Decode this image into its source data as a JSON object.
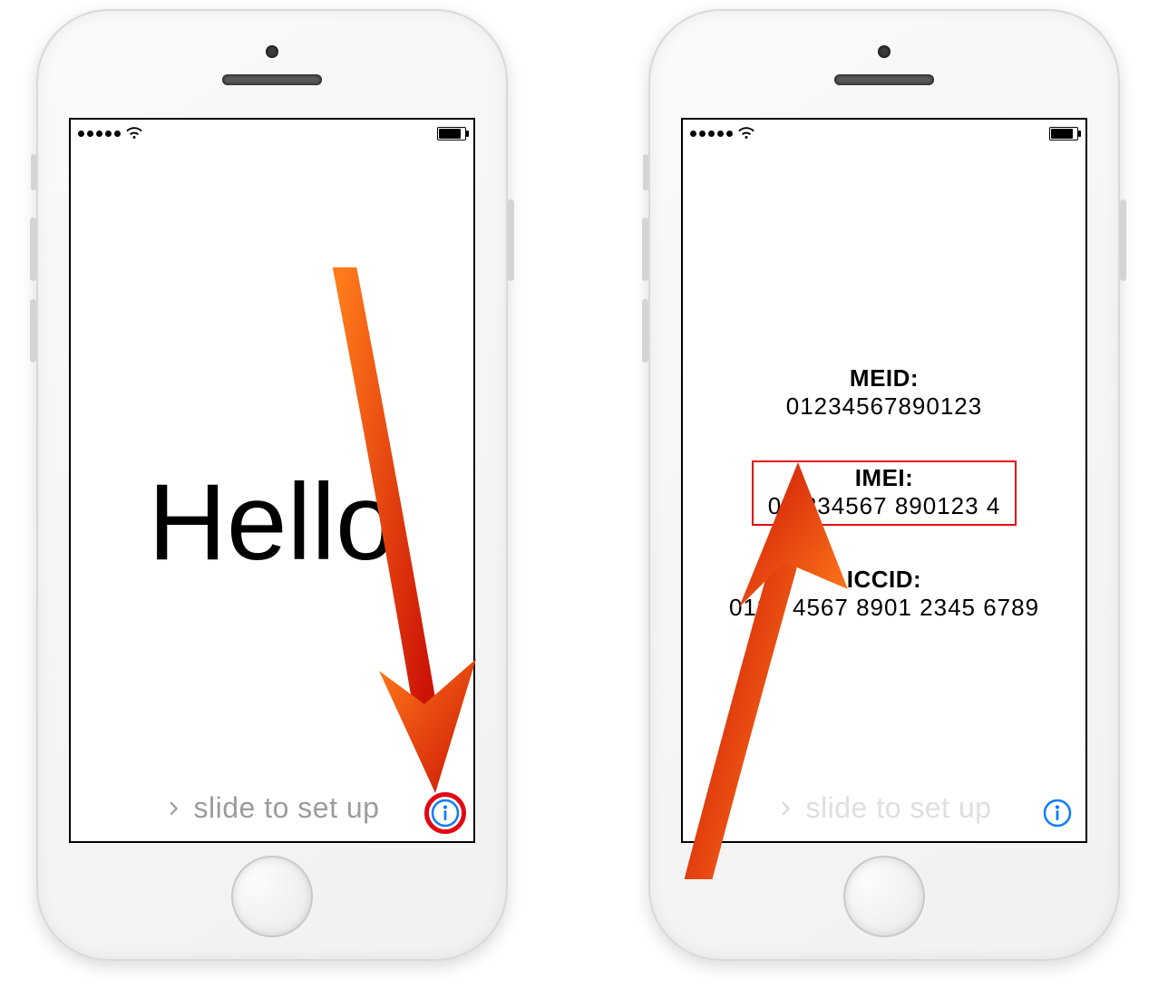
{
  "left": {
    "hello": "Hello",
    "slide_text": "slide to set up",
    "greeting_text": "Hello"
  },
  "right": {
    "slide_text": "slide to set up",
    "fields": {
      "meid_label": "MEID:",
      "meid_value": "01234567890123",
      "imei_label": "IMEI:",
      "imei_value": "01 234567 890123 4",
      "iccid_label": "ICCID:",
      "iccid_value": "0123 4567 8901 2345 6789"
    }
  },
  "annotation": {
    "highlight_color": "#e30613",
    "arrow_color_a": "#ff6a13",
    "arrow_color_b": "#d11507"
  }
}
